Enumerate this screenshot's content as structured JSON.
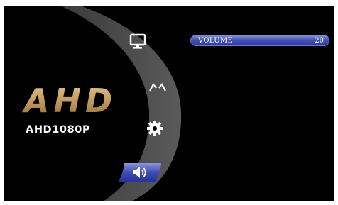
{
  "brand": {
    "logo_text": "AHD",
    "model": "AHD1080P"
  },
  "menu": {
    "items": [
      {
        "id": "display",
        "icon": "monitor-icon",
        "selected": false
      },
      {
        "id": "adjust",
        "icon": "chevrons-icon",
        "selected": false
      },
      {
        "id": "settings",
        "icon": "gear-icon",
        "selected": false
      },
      {
        "id": "volume",
        "icon": "speaker-icon",
        "selected": true
      }
    ]
  },
  "volume": {
    "label": "VOLUME",
    "value": "20"
  },
  "colors": {
    "background": "#000000",
    "arc": "#4a4a4a",
    "logo_gold": "#c9a66b",
    "highlight_blue": "#3b4ab0",
    "text": "#ffffff"
  }
}
